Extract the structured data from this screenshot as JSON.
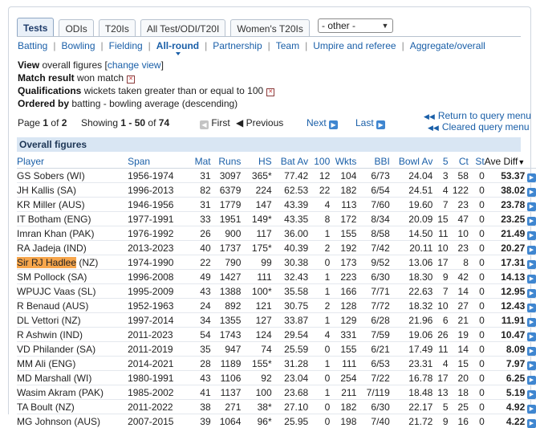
{
  "tabs": [
    {
      "label": "Tests",
      "active": true
    },
    {
      "label": "ODIs",
      "active": false
    },
    {
      "label": "T20Is",
      "active": false
    },
    {
      "label": "All Test/ODI/T20I",
      "active": false
    },
    {
      "label": "Women's T20Is",
      "active": false
    }
  ],
  "other_select": {
    "value": "- other -"
  },
  "subnav": [
    "Batting",
    "Bowling",
    "Fielding",
    "All-round",
    "Partnership",
    "Team",
    "Umpire and referee",
    "Aggregate/overall"
  ],
  "view": {
    "label": "View",
    "text": "overall figures",
    "link": "change view"
  },
  "match_result": {
    "label": "Match result",
    "text": "won match"
  },
  "qualifications": {
    "label": "Qualifications",
    "text": "wickets taken greater than or equal to 100"
  },
  "ordered_by": {
    "label": "Ordered by",
    "text": "batting - bowling average (descending)"
  },
  "pager": {
    "page_prefix": "Page",
    "page": "1",
    "of": "of",
    "pages": "2",
    "showing_prefix": "Showing",
    "range": "1 - 50",
    "total": "74",
    "first": "First",
    "previous": "Previous",
    "next": "Next",
    "last": "Last"
  },
  "query_links": {
    "return": "Return to query menu",
    "cleared": "Cleared query menu"
  },
  "table": {
    "caption": "Overall figures",
    "headers": [
      "Player",
      "Span",
      "Mat",
      "Runs",
      "HS",
      "Bat Av",
      "100",
      "Wkts",
      "BBI",
      "Bowl Av",
      "5",
      "Ct",
      "St",
      "Ave Diff"
    ],
    "rows": [
      {
        "player": "GS Sobers",
        "team": "(WI)",
        "span": "1956-1974",
        "mat": "31",
        "runs": "3097",
        "hs": "365*",
        "batav": "77.42",
        "h100": "12",
        "wkts": "104",
        "bbi": "6/73",
        "bowlav": "24.04",
        "f5": "3",
        "ct": "58",
        "st": "0",
        "avediff": "53.37"
      },
      {
        "player": "JH Kallis",
        "team": "(SA)",
        "span": "1996-2013",
        "mat": "82",
        "runs": "6379",
        "hs": "224",
        "batav": "62.53",
        "h100": "22",
        "wkts": "182",
        "bbi": "6/54",
        "bowlav": "24.51",
        "f5": "4",
        "ct": "122",
        "st": "0",
        "avediff": "38.02"
      },
      {
        "player": "KR Miller",
        "team": "(AUS)",
        "span": "1946-1956",
        "mat": "31",
        "runs": "1779",
        "hs": "147",
        "batav": "43.39",
        "h100": "4",
        "wkts": "113",
        "bbi": "7/60",
        "bowlav": "19.60",
        "f5": "7",
        "ct": "23",
        "st": "0",
        "avediff": "23.78"
      },
      {
        "player": "IT Botham",
        "team": "(ENG)",
        "span": "1977-1991",
        "mat": "33",
        "runs": "1951",
        "hs": "149*",
        "batav": "43.35",
        "h100": "8",
        "wkts": "172",
        "bbi": "8/34",
        "bowlav": "20.09",
        "f5": "15",
        "ct": "47",
        "st": "0",
        "avediff": "23.25"
      },
      {
        "player": "Imran Khan",
        "team": "(PAK)",
        "span": "1976-1992",
        "mat": "26",
        "runs": "900",
        "hs": "117",
        "batav": "36.00",
        "h100": "1",
        "wkts": "155",
        "bbi": "8/58",
        "bowlav": "14.50",
        "f5": "11",
        "ct": "10",
        "st": "0",
        "avediff": "21.49"
      },
      {
        "player": "RA Jadeja",
        "team": "(IND)",
        "span": "2013-2023",
        "mat": "40",
        "runs": "1737",
        "hs": "175*",
        "batav": "40.39",
        "h100": "2",
        "wkts": "192",
        "bbi": "7/42",
        "bowlav": "20.11",
        "f5": "10",
        "ct": "23",
        "st": "0",
        "avediff": "20.27"
      },
      {
        "player": "Sir RJ Hadlee",
        "team": "(NZ)",
        "span": "1974-1990",
        "mat": "22",
        "runs": "790",
        "hs": "99",
        "batav": "30.38",
        "h100": "0",
        "wkts": "173",
        "bbi": "9/52",
        "bowlav": "13.06",
        "f5": "17",
        "ct": "8",
        "st": "0",
        "avediff": "17.31",
        "highlight": true
      },
      {
        "player": "SM Pollock",
        "team": "(SA)",
        "span": "1996-2008",
        "mat": "49",
        "runs": "1427",
        "hs": "111",
        "batav": "32.43",
        "h100": "1",
        "wkts": "223",
        "bbi": "6/30",
        "bowlav": "18.30",
        "f5": "9",
        "ct": "42",
        "st": "0",
        "avediff": "14.13"
      },
      {
        "player": "WPUJC Vaas",
        "team": "(SL)",
        "span": "1995-2009",
        "mat": "43",
        "runs": "1388",
        "hs": "100*",
        "batav": "35.58",
        "h100": "1",
        "wkts": "166",
        "bbi": "7/71",
        "bowlav": "22.63",
        "f5": "7",
        "ct": "14",
        "st": "0",
        "avediff": "12.95"
      },
      {
        "player": "R Benaud",
        "team": "(AUS)",
        "span": "1952-1963",
        "mat": "24",
        "runs": "892",
        "hs": "121",
        "batav": "30.75",
        "h100": "2",
        "wkts": "128",
        "bbi": "7/72",
        "bowlav": "18.32",
        "f5": "10",
        "ct": "27",
        "st": "0",
        "avediff": "12.43"
      },
      {
        "player": "DL Vettori",
        "team": "(NZ)",
        "span": "1997-2014",
        "mat": "34",
        "runs": "1355",
        "hs": "127",
        "batav": "33.87",
        "h100": "1",
        "wkts": "129",
        "bbi": "6/28",
        "bowlav": "21.96",
        "f5": "6",
        "ct": "21",
        "st": "0",
        "avediff": "11.91"
      },
      {
        "player": "R Ashwin",
        "team": "(IND)",
        "span": "2011-2023",
        "mat": "54",
        "runs": "1743",
        "hs": "124",
        "batav": "29.54",
        "h100": "4",
        "wkts": "331",
        "bbi": "7/59",
        "bowlav": "19.06",
        "f5": "26",
        "ct": "19",
        "st": "0",
        "avediff": "10.47"
      },
      {
        "player": "VD Philander",
        "team": "(SA)",
        "span": "2011-2019",
        "mat": "35",
        "runs": "947",
        "hs": "74",
        "batav": "25.59",
        "h100": "0",
        "wkts": "155",
        "bbi": "6/21",
        "bowlav": "17.49",
        "f5": "11",
        "ct": "14",
        "st": "0",
        "avediff": "8.09"
      },
      {
        "player": "MM Ali",
        "team": "(ENG)",
        "span": "2014-2021",
        "mat": "28",
        "runs": "1189",
        "hs": "155*",
        "batav": "31.28",
        "h100": "1",
        "wkts": "111",
        "bbi": "6/53",
        "bowlav": "23.31",
        "f5": "4",
        "ct": "15",
        "st": "0",
        "avediff": "7.97"
      },
      {
        "player": "MD Marshall",
        "team": "(WI)",
        "span": "1980-1991",
        "mat": "43",
        "runs": "1106",
        "hs": "92",
        "batav": "23.04",
        "h100": "0",
        "wkts": "254",
        "bbi": "7/22",
        "bowlav": "16.78",
        "f5": "17",
        "ct": "20",
        "st": "0",
        "avediff": "6.25"
      },
      {
        "player": "Wasim Akram",
        "team": "(PAK)",
        "span": "1985-2002",
        "mat": "41",
        "runs": "1137",
        "hs": "100",
        "batav": "23.68",
        "h100": "1",
        "wkts": "211",
        "bbi": "7/119",
        "bowlav": "18.48",
        "f5": "13",
        "ct": "18",
        "st": "0",
        "avediff": "5.19"
      },
      {
        "player": "TA Boult",
        "team": "(NZ)",
        "span": "2011-2022",
        "mat": "38",
        "runs": "271",
        "hs": "38*",
        "batav": "27.10",
        "h100": "0",
        "wkts": "182",
        "bbi": "6/30",
        "bowlav": "22.17",
        "f5": "5",
        "ct": "25",
        "st": "0",
        "avediff": "4.92"
      },
      {
        "player": "MG Johnson",
        "team": "(AUS)",
        "span": "2007-2015",
        "mat": "39",
        "runs": "1064",
        "hs": "96*",
        "batav": "25.95",
        "h100": "0",
        "wkts": "198",
        "bbi": "7/40",
        "bowlav": "21.72",
        "f5": "9",
        "ct": "16",
        "st": "0",
        "avediff": "4.22"
      }
    ]
  }
}
